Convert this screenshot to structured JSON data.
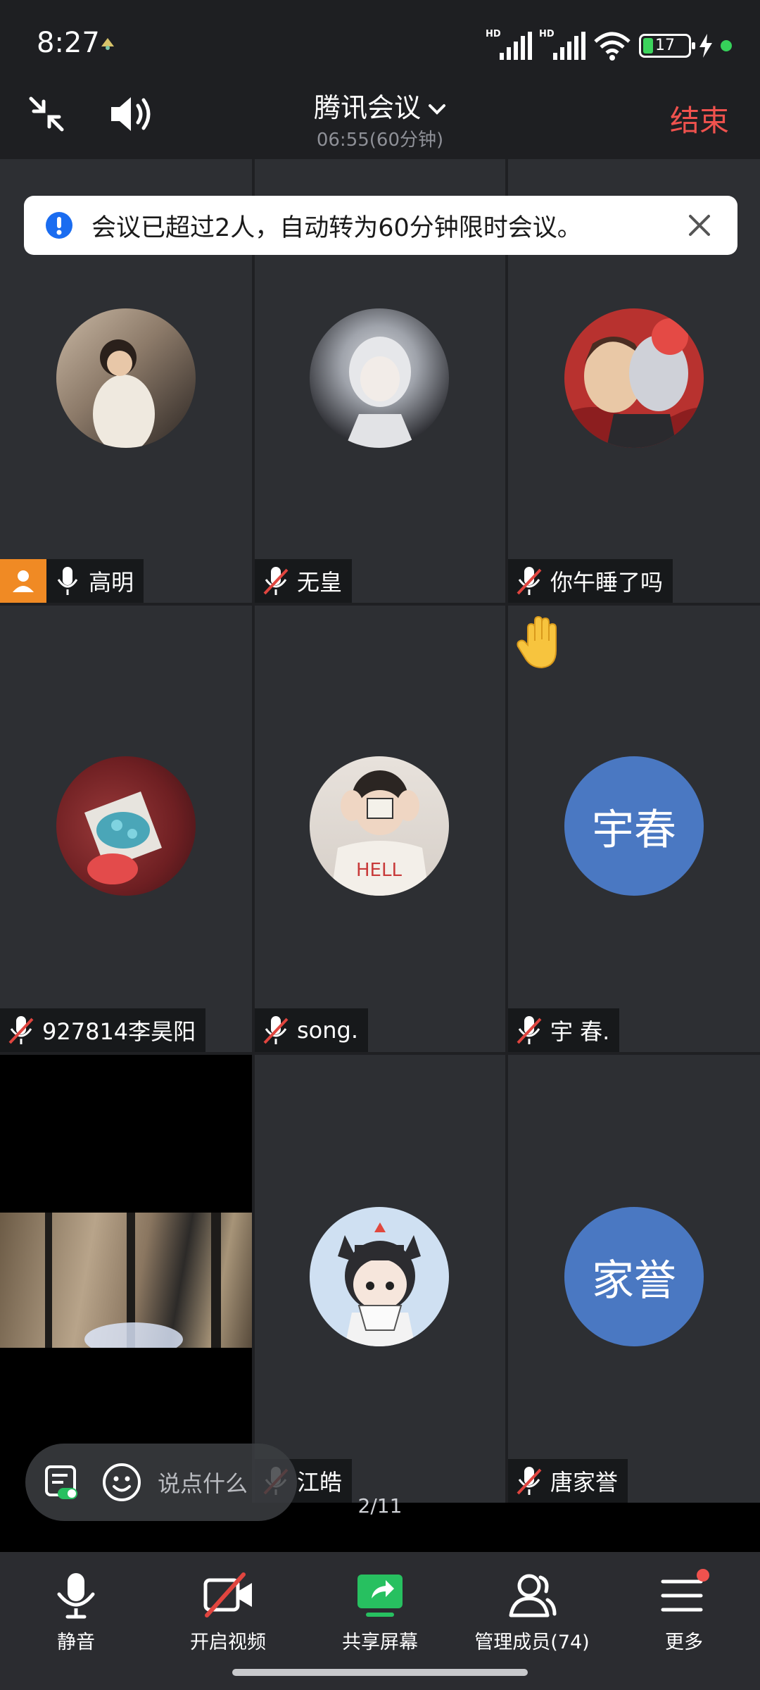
{
  "status_bar": {
    "time": "8:27",
    "signal1_label": "HD",
    "signal2_label": "HD",
    "battery_level": "17",
    "notification_icon": "app-notification-icon",
    "charging_icon": "bolt-icon"
  },
  "header": {
    "title": "腾讯会议",
    "timer": "06:55(60分钟)",
    "end_label": "结束"
  },
  "notice": {
    "message": "会议已超过2人，自动转为60分钟限时会议。"
  },
  "participants": [
    {
      "name": "高明",
      "mic": "on",
      "host": true,
      "avatar": "photo"
    },
    {
      "name": "无皇",
      "mic": "off",
      "avatar": "photo"
    },
    {
      "name": "你午睡了吗",
      "mic": "off",
      "avatar": "photo"
    },
    {
      "name": "927814李昊阳",
      "mic": "off",
      "avatar": "photo"
    },
    {
      "name": "song.",
      "mic": "off",
      "avatar": "photo"
    },
    {
      "name": "宇 春.",
      "mic": "off",
      "avatar_initials": "宇春",
      "hand_raised": true
    },
    {
      "name": "",
      "mic": "off",
      "avatar": "video"
    },
    {
      "name": "江皓",
      "mic": "off",
      "avatar": "photo"
    },
    {
      "name": "唐家誉",
      "mic": "off",
      "avatar_initials": "家誉"
    }
  ],
  "page_indicator": "2/11",
  "chat": {
    "placeholder": "说点什么"
  },
  "toolbar": {
    "mute_label": "静音",
    "video_label": "开启视频",
    "share_label": "共享屏幕",
    "members_label": "管理成员(74)",
    "more_label": "更多"
  },
  "colors": {
    "end": "#f0524e",
    "initial_avatar": "#4a78c2",
    "host_badge": "#f08a24",
    "share_green": "#27c060"
  }
}
